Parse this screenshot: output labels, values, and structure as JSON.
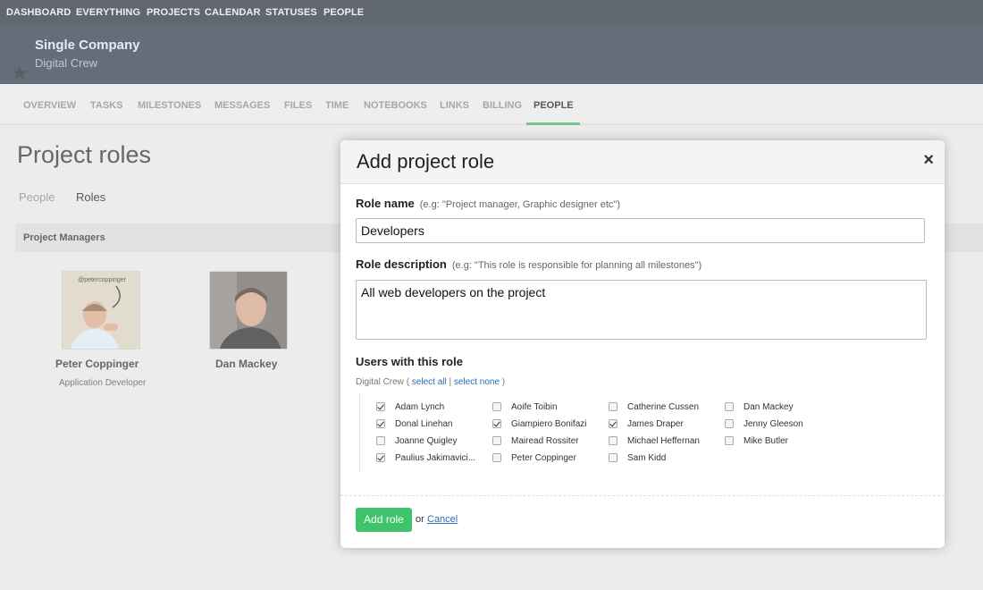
{
  "topnav": {
    "items": [
      "DASHBOARD",
      "EVERYTHING",
      "PROJECTS",
      "CALENDAR",
      "STATUSES",
      "PEOPLE"
    ]
  },
  "project": {
    "company": "Single Company",
    "name": "Digital Crew"
  },
  "project_tabs": [
    "OVERVIEW",
    "TASKS",
    "MILESTONES",
    "MESSAGES",
    "FILES",
    "TIME",
    "NOTEBOOKS",
    "LINKS",
    "BILLING",
    "PEOPLE"
  ],
  "active_project_tab": "PEOPLE",
  "page": {
    "title": "Project roles",
    "subtabs": [
      "People",
      "Roles"
    ],
    "active_subtab": "Roles",
    "section_label": "Project Managers",
    "people": [
      {
        "name": "Peter Coppinger",
        "title": "Application Developer",
        "avatar_caption": "@petercoppinger"
      },
      {
        "name": "Dan Mackey",
        "title": ""
      }
    ]
  },
  "modal": {
    "title": "Add project role",
    "close_label": "×",
    "role_name_label": "Role name",
    "role_name_hint": "(e.g: \"Project manager, Graphic designer etc\")",
    "role_name_value": "Developers",
    "role_desc_label": "Role description",
    "role_desc_hint": "(e.g: \"This role is responsible for planning all milestones\")",
    "role_desc_value": "All web developers on the project",
    "users_heading": "Users with this role",
    "group_name": "Digital Crew",
    "select_all": "select all",
    "select_none": "select none",
    "users": [
      {
        "name": "Adam Lynch",
        "checked": true
      },
      {
        "name": "Aoife Toibin",
        "checked": false
      },
      {
        "name": "Catherine Cussen",
        "checked": false
      },
      {
        "name": "Dan Mackey",
        "checked": false
      },
      {
        "name": "Donal Linehan",
        "checked": true
      },
      {
        "name": "Giampiero Bonifazi",
        "checked": true
      },
      {
        "name": "James Draper",
        "checked": true
      },
      {
        "name": "Jenny Gleeson",
        "checked": false
      },
      {
        "name": "Joanne Quigley",
        "checked": false
      },
      {
        "name": "Mairead Rossiter",
        "checked": false
      },
      {
        "name": "Michael Heffernan",
        "checked": false
      },
      {
        "name": "Mike Butler",
        "checked": false
      },
      {
        "name": "Paulius Jakimavici...",
        "checked": true
      },
      {
        "name": "Peter Coppinger",
        "checked": false
      },
      {
        "name": "Sam Kidd",
        "checked": false
      }
    ],
    "add_button": "Add role",
    "or_text": "or",
    "cancel_link": "Cancel"
  },
  "colors": {
    "topnav_bg": "#2b3440",
    "header_bg": "#303d4e",
    "accent_green": "#3ec46a",
    "link_blue": "#2a6db0"
  }
}
